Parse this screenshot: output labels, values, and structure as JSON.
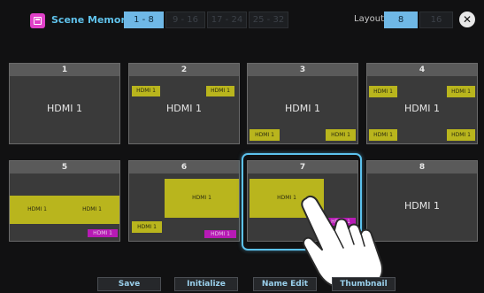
{
  "header": {
    "title": "Scene Memory",
    "tabs": [
      "1 - 8",
      "9 - 16",
      "17 - 24",
      "25 - 32"
    ],
    "layout_label": "Layout",
    "layout_options": [
      "8",
      "16"
    ],
    "close_icon": "close-icon"
  },
  "cells": [
    {
      "number": "1",
      "main_label": "HDMI 1"
    },
    {
      "number": "2",
      "main_label": "HDMI 1",
      "tag_left": "HDMI 1",
      "tag_right": "HDMI 1"
    },
    {
      "number": "3",
      "main_label": "HDMI 1",
      "tag_left": "HDMI 1",
      "tag_right": "HDMI 1"
    },
    {
      "number": "4",
      "main_label": "HDMI 1",
      "tag_tl": "HDMI 1",
      "tag_tr": "HDMI 1",
      "tag_bl": "HDMI 1",
      "tag_br": "HDMI 1"
    },
    {
      "number": "5",
      "tag_left": "HDMI 1",
      "tag_right": "HDMI 1",
      "tag_pink": "HDMI 1"
    },
    {
      "number": "6",
      "tag_center": "HDMI 1",
      "tag_bottom_left": "HDMI 1",
      "tag_pink": "HDMI 1"
    },
    {
      "number": "7",
      "tag_main": "HDMI 1",
      "tag_pink": "HDMI 1"
    },
    {
      "number": "8",
      "main_label": "HDMI 1"
    }
  ],
  "bottom_buttons": [
    "Save",
    "Initialize",
    "Name Edit",
    "Thumbnail"
  ],
  "colors": {
    "accent": "#6fb8e6",
    "tile_yellow": "#b9b51d",
    "tile_magenta": "#b71ab5",
    "highlight": "#5cc2ee"
  }
}
